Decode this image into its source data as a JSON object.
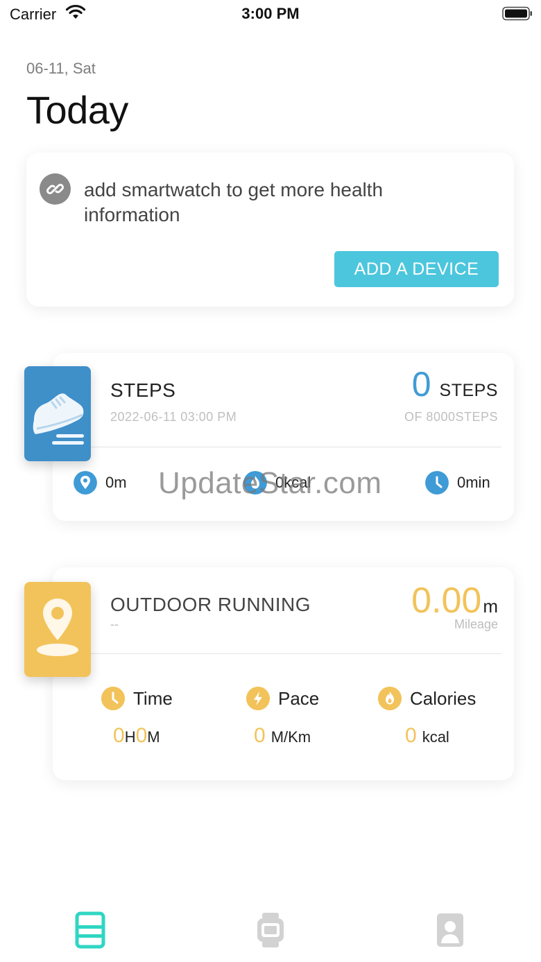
{
  "status_bar": {
    "carrier": "Carrier",
    "time": "3:00 PM",
    "wifi_icon": "wifi-icon",
    "battery_icon": "battery-icon"
  },
  "header": {
    "date": "06-11, Sat",
    "title": "Today"
  },
  "device_card": {
    "message": "add smartwatch to get more health information",
    "button_label": "ADD A DEVICE",
    "icon": "link-icon",
    "button_color": "#4cc6dd"
  },
  "steps": {
    "title": "STEPS",
    "timestamp": "2022-06-11 03:00 PM",
    "value": "0",
    "unit": "STEPS",
    "goal": "OF 8000STEPS",
    "distance": "0m",
    "calories": "0kcal",
    "duration": "0min",
    "accent": "#3f8fc9"
  },
  "watermark": "UpdateStar.com",
  "running": {
    "title": "OUTDOOR RUNNING",
    "subtitle": "--",
    "mileage": "0.00",
    "mileage_unit": "m",
    "mileage_label": "Mileage",
    "time_label": "Time",
    "pace_label": "Pace",
    "calories_label": "Calories",
    "time_hours": "0",
    "time_h_unit": "H",
    "time_minutes": "0",
    "time_m_unit": "M",
    "pace_value": "0",
    "pace_unit": "M/Km",
    "calories_value": "0",
    "calories_unit": "kcal",
    "accent": "#f2c35a"
  },
  "tab_bar": {
    "tabs": [
      {
        "icon": "today-tab-icon",
        "active": true
      },
      {
        "icon": "watch-tab-icon",
        "active": false
      },
      {
        "icon": "profile-tab-icon",
        "active": false
      }
    ],
    "active_color": "#2fd6c3",
    "inactive_color": "#d2d2d2"
  }
}
